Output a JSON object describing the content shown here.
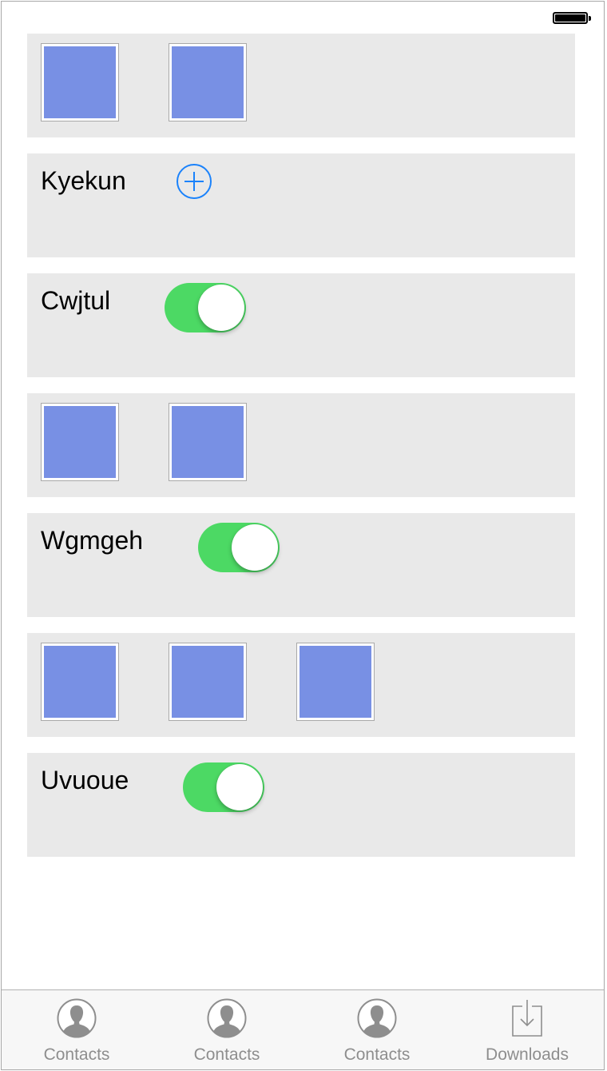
{
  "status_bar": {
    "battery_level": 1.0
  },
  "rows": [
    {
      "type": "images",
      "count": 2
    },
    {
      "type": "add",
      "label": "Kyekun",
      "icon": "plus-circle-icon"
    },
    {
      "type": "toggle",
      "label": "Cwjtul",
      "on": true
    },
    {
      "type": "images",
      "count": 2
    },
    {
      "type": "toggle",
      "label": "Wgmgeh",
      "on": true
    },
    {
      "type": "images",
      "count": 3
    },
    {
      "type": "toggle",
      "label": "Uvuoue",
      "on": true
    }
  ],
  "colors": {
    "row_background": "#e9e9e9",
    "thumbnail_fill": "#7890e4",
    "toggle_on": "#4cd964",
    "accent_blue": "#1a82fb",
    "tab_inactive": "#8e8e8e"
  },
  "tab_bar": {
    "items": [
      {
        "label": "Contacts",
        "icon": "contacts-icon"
      },
      {
        "label": "Contacts",
        "icon": "contacts-icon"
      },
      {
        "label": "Contacts",
        "icon": "contacts-icon"
      },
      {
        "label": "Downloads",
        "icon": "downloads-icon"
      }
    ]
  }
}
